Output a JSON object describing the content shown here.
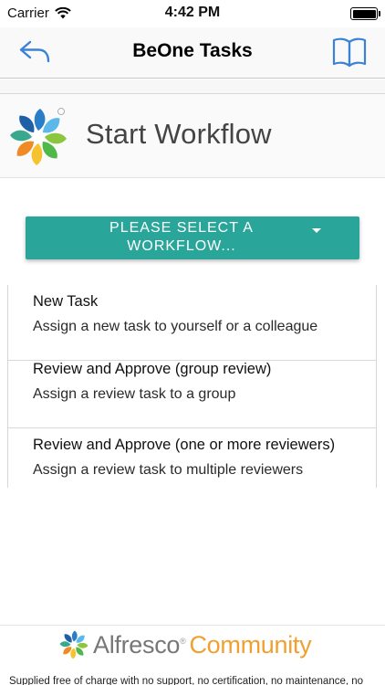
{
  "status_bar": {
    "carrier": "Carrier",
    "time": "4:42 PM"
  },
  "nav": {
    "title": "BeOne Tasks",
    "back_icon": "back-arrow-icon",
    "right_icon": "book-icon",
    "accent_color": "#3b82d6"
  },
  "header": {
    "title": "Start Workflow",
    "logo_icon": "alfresco-flower-icon"
  },
  "select_button": {
    "label": "PLEASE SELECT A WORKFLOW...",
    "color": "#2aa59a"
  },
  "workflows": [
    {
      "title": "New Task",
      "description": "Assign a new task to yourself or a colleague"
    },
    {
      "title": "Review and Approve (group review)",
      "description": "Assign a review task to a group"
    },
    {
      "title": "Review and Approve (one or more reviewers)",
      "description": "Assign a review task to multiple reviewers"
    }
  ],
  "footer": {
    "brand": "Alfresco",
    "edition": "Community",
    "note": "Supplied free of charge with no support, no certification, no maintenance, no"
  }
}
